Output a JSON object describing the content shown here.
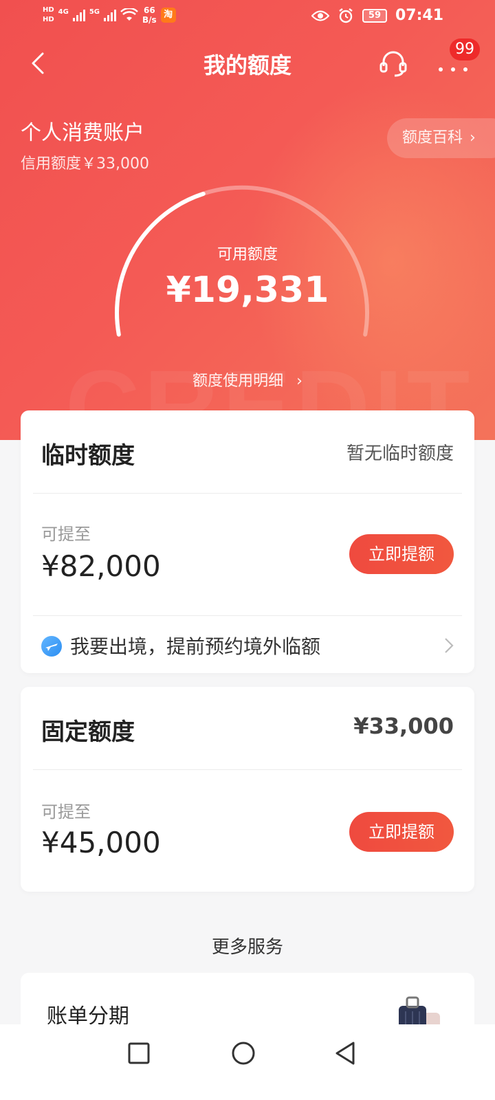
{
  "status_bar": {
    "hd1": "HD",
    "hd2": "HD",
    "net1": "4G",
    "net2": "5G",
    "speed_value": "66",
    "speed_unit": "B/s",
    "app_badge": "淘",
    "battery": "59",
    "time": "07:41"
  },
  "nav": {
    "title": "我的额度",
    "badge": "99"
  },
  "account": {
    "title": "个人消费账户",
    "credit_limit": "信用额度￥33,000",
    "wiki_label": "额度百科",
    "wiki_chevron": "›"
  },
  "gauge": {
    "label": "可用额度",
    "value": "¥19,331",
    "fraction_used": 0.41,
    "detail_link": "额度使用明细",
    "detail_chevron": "›"
  },
  "temporary": {
    "title": "临时额度",
    "status": "暂无临时额度",
    "upto_label": "可提至",
    "upto_value": "¥82,000",
    "button": "立即提额",
    "abroad_text": "我要出境，提前预约境外临额"
  },
  "fixed": {
    "title": "固定额度",
    "amount": "¥33,000",
    "upto_label": "可提至",
    "upto_value": "¥45,000",
    "button": "立即提额"
  },
  "more_services": {
    "title": "更多服务",
    "items": [
      {
        "label": "账单分期",
        "icon": "luggage-icon"
      }
    ]
  },
  "colors": {
    "hero_red": "#f1504f",
    "button_red": "#ef4a3f",
    "badge_red": "#ee2a2a"
  }
}
